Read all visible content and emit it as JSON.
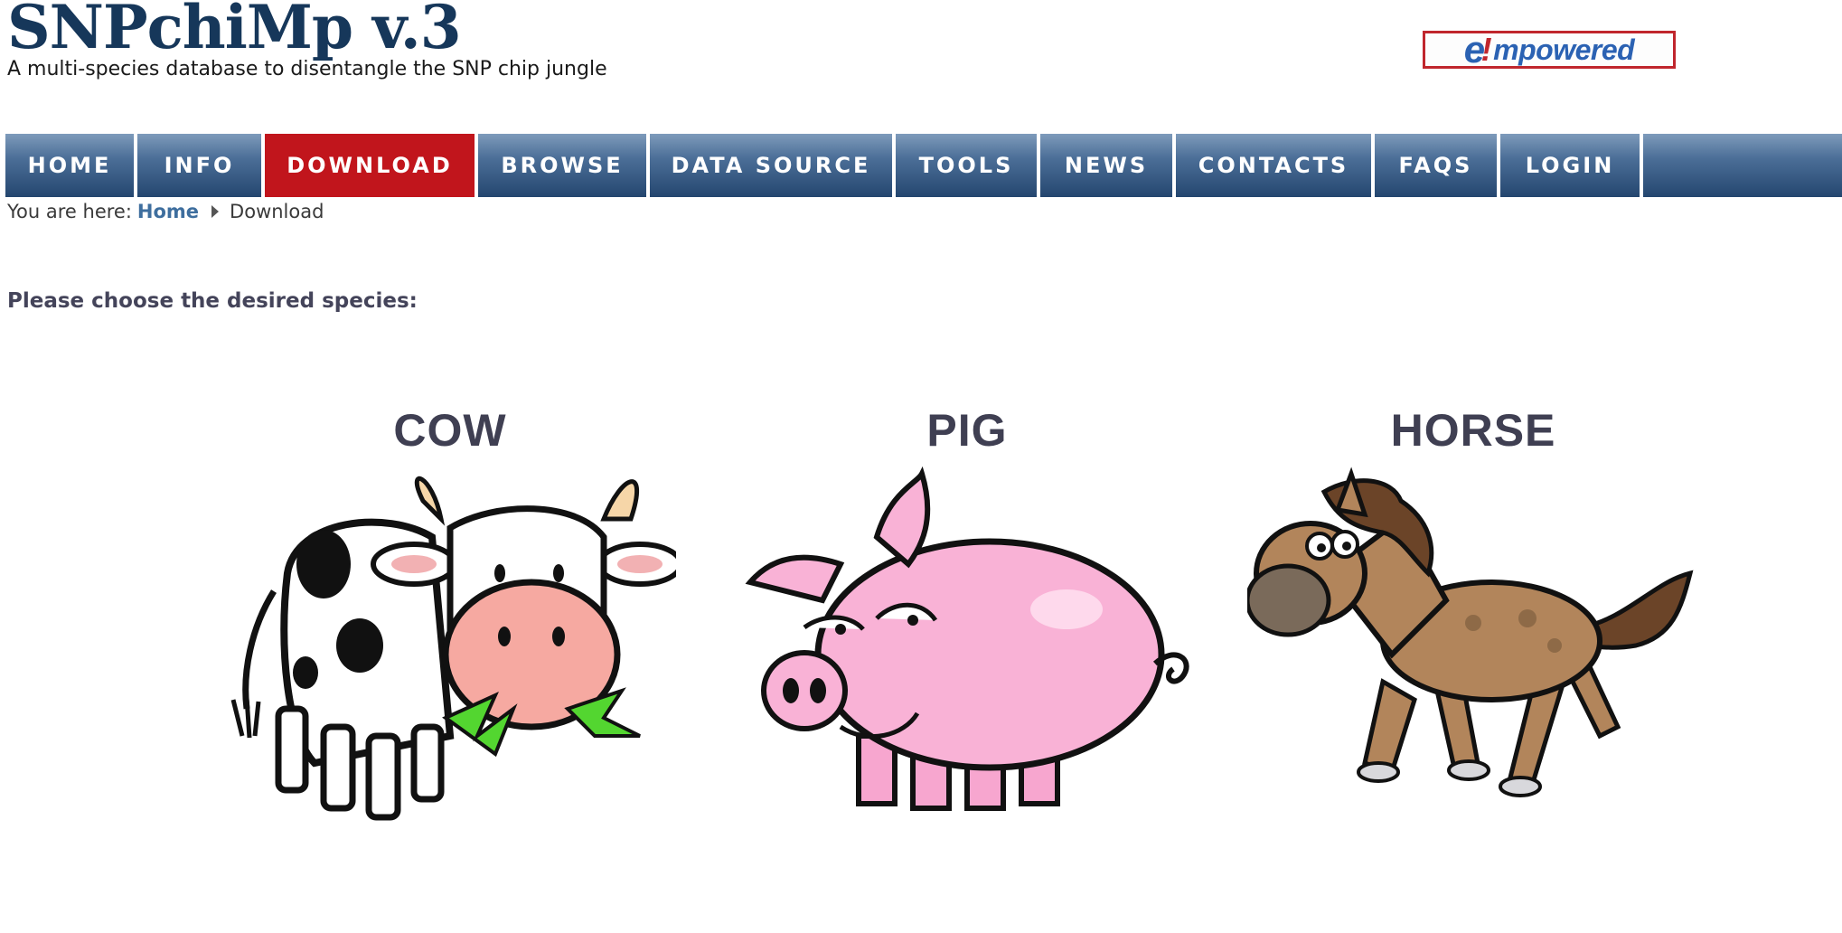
{
  "header": {
    "title": "SNPchiMp v.3",
    "tagline": "A multi-species database to disentangle the SNP chip jungle",
    "logo": {
      "e": "e",
      "bang": "!",
      "rest": "mpowered"
    }
  },
  "nav": {
    "items": [
      {
        "label": "HOME"
      },
      {
        "label": "INFO"
      },
      {
        "label": "DOWNLOAD",
        "active": true
      },
      {
        "label": "BROWSE"
      },
      {
        "label": "DATA SOURCE"
      },
      {
        "label": "TOOLS"
      },
      {
        "label": "NEWS"
      },
      {
        "label": "CONTACTS"
      },
      {
        "label": "FAQS"
      },
      {
        "label": "LOGIN"
      }
    ],
    "active_color": "#c1151c",
    "bar_color": "#24466f"
  },
  "breadcrumb": {
    "prefix": "You are here:",
    "home": "Home",
    "current": "Download"
  },
  "main": {
    "prompt": "Please choose the desired species:",
    "species": [
      {
        "label": "COW",
        "icon": "cow-icon"
      },
      {
        "label": "PIG",
        "icon": "pig-icon"
      },
      {
        "label": "HORSE",
        "icon": "horse-icon"
      }
    ]
  }
}
